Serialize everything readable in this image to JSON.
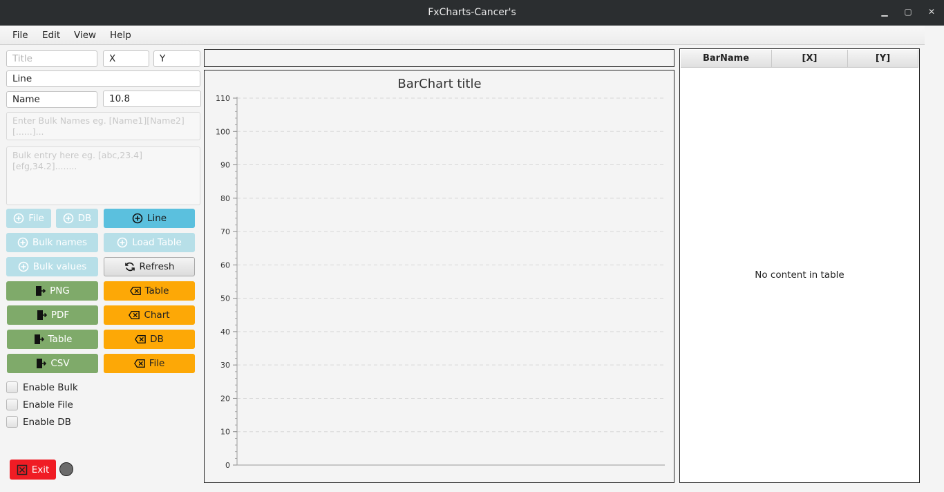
{
  "window": {
    "title": "FxCharts-Cancer's",
    "minimize": "▁",
    "maximize": "▢",
    "close": "✕"
  },
  "menu": [
    "File",
    "Edit",
    "View",
    "Help"
  ],
  "inputs": {
    "title_placeholder": "Title",
    "x_value": "X",
    "y_value": "Y",
    "series_value": "Line",
    "name_value": "Name",
    "number_value": "10.8",
    "bulk_names_placeholder": "Enter Bulk Names          eg. [Name1][Name2][......]...",
    "bulk_entry_placeholder": "Bulk entry here eg. [abc,23.4][efg,34.2]........"
  },
  "buttons": {
    "file": "File",
    "db": "DB",
    "line": "Line",
    "bulk_names": "Bulk names",
    "load_table": "Load Table",
    "bulk_values": "Bulk values",
    "refresh": "Refresh",
    "png": "PNG",
    "pdf": "PDF",
    "export_table": "Table",
    "csv": "CSV",
    "clear_table": "Table",
    "clear_chart": "Chart",
    "clear_db": "DB",
    "clear_file": "File",
    "exit": "Exit"
  },
  "checkboxes": [
    "Enable Bulk",
    "Enable File",
    "Enable DB"
  ],
  "table": {
    "columns": [
      "BarName",
      "[X]",
      "[Y]"
    ],
    "empty_text": "No content in table"
  },
  "colors": {
    "disabled_blue": "#b7dfe8",
    "primary_blue": "#5bc0de",
    "export_green": "#7faa6a",
    "clear_orange": "#fda806",
    "exit_red": "#f01c24"
  },
  "chart_data": {
    "type": "bar",
    "title": "BarChart title",
    "categories": [],
    "series": [],
    "ylim": [
      0,
      110
    ],
    "yticks": [
      "0",
      "10",
      "20",
      "30",
      "40",
      "50",
      "60",
      "70",
      "80",
      "90",
      "100",
      "110"
    ],
    "grid": true
  }
}
